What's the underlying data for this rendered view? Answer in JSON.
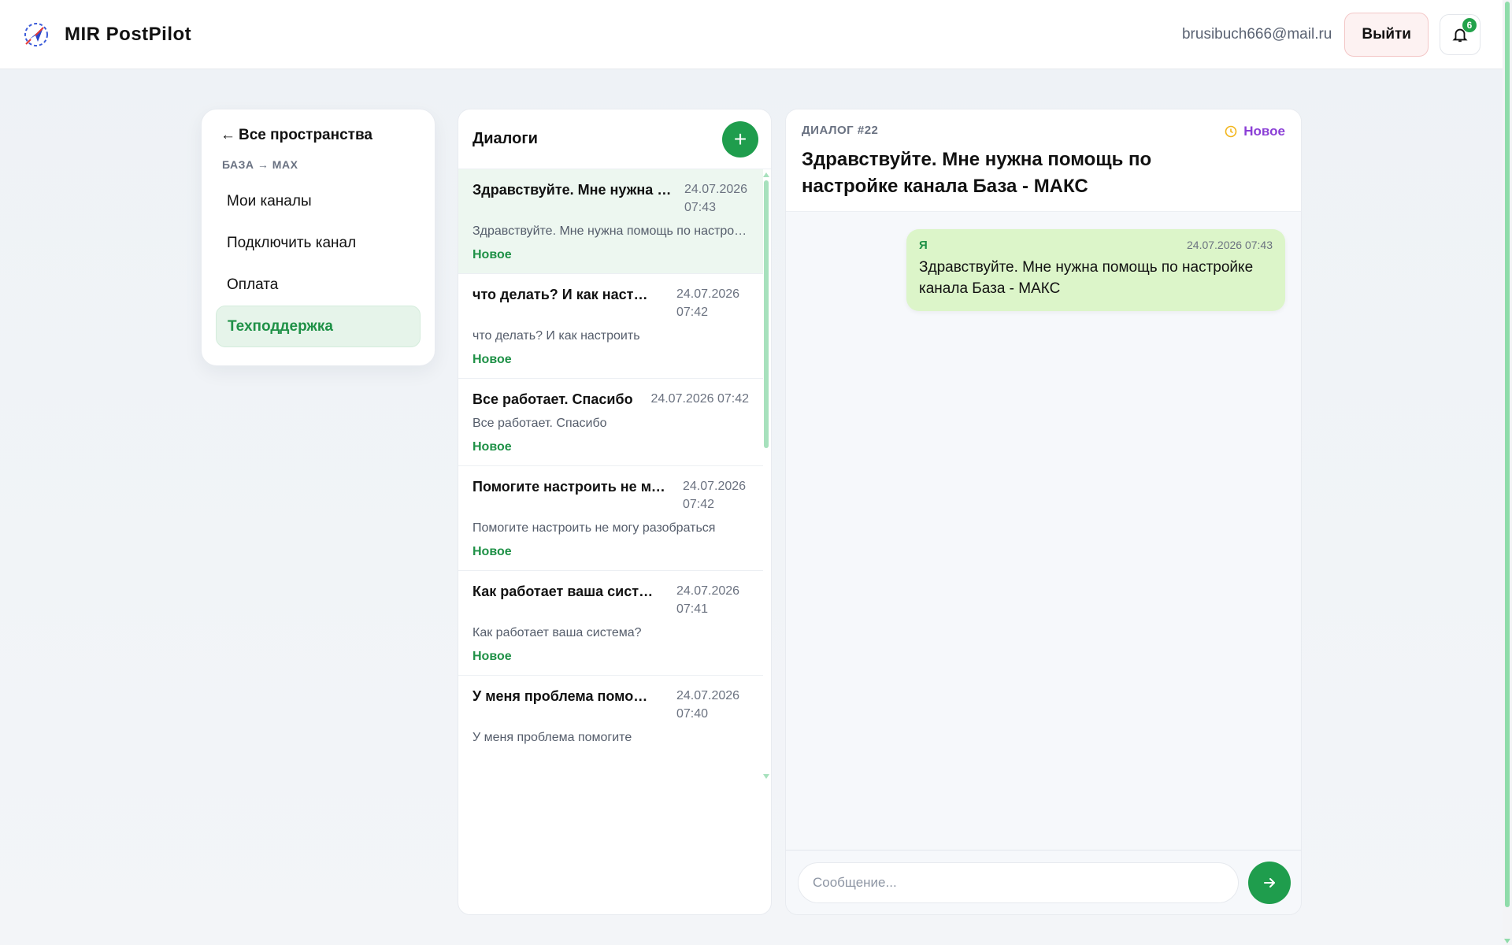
{
  "app": {
    "name": "MIR PostPilot",
    "user_email": "brusibuch666@mail.ru",
    "logout_label": "Выйти",
    "notification_count": "6",
    "accent_color": "#1f9d4d"
  },
  "sidebar": {
    "back_label": "Все пространства",
    "breadcrumb": "БАЗА → MAX",
    "items": [
      {
        "label": "Мои каналы",
        "active": false
      },
      {
        "label": "Подключить канал",
        "active": false
      },
      {
        "label": "Оплата",
        "active": false
      },
      {
        "label": "Техподдержка",
        "active": true
      }
    ]
  },
  "dialogs": {
    "title": "Диалоги",
    "add_icon": "plus-icon",
    "items": [
      {
        "title": "Здравствуйте. Мне нужна помощь по настройке канала База - МАКС",
        "date": "24.07.2026 07:43",
        "preview": "Здравствуйте. Мне нужна помощь по настройке канала База - МАКС",
        "status": "Новое",
        "active": true
      },
      {
        "title": "что делать? И как настроить",
        "date": "24.07.2026 07:42",
        "preview": "что делать? И как настроить",
        "status": "Новое",
        "active": false
      },
      {
        "title": "Все работает. Спасибо",
        "date": "24.07.2026 07:42",
        "preview": "Все работает. Спасибо",
        "status": "Новое",
        "active": false
      },
      {
        "title": "Помогите настроить не могу разобраться",
        "date": "24.07.2026 07:42",
        "preview": "Помогите настроить не могу разобраться",
        "status": "Новое",
        "active": false
      },
      {
        "title": "Как работает ваша система?",
        "date": "24.07.2026 07:41",
        "preview": "Как работает ваша система?",
        "status": "Новое",
        "active": false
      },
      {
        "title": "У меня проблема помогите",
        "date": "24.07.2026 07:40",
        "preview": "У меня проблема помогите",
        "status": "",
        "active": false
      }
    ]
  },
  "chat": {
    "kicker": "ДИАЛОГ #22",
    "title": "Здравствуйте. Мне нужна помощь по настройке канала База - МАКС",
    "status": "Новое",
    "status_icon": "clock-icon",
    "messages": [
      {
        "author": "Я",
        "time": "24.07.2026 07:43",
        "text": "Здравствуйте. Мне нужна помощь по настройке канала База - МАКС"
      }
    ],
    "input_placeholder": "Сообщение...",
    "send_icon": "arrow-right-icon"
  }
}
